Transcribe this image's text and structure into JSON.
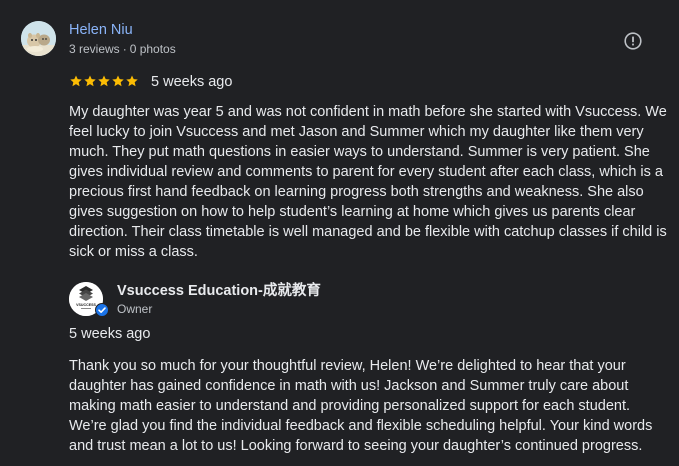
{
  "review": {
    "reviewer_name": "Helen Niu",
    "reviews_count": "3 reviews",
    "separator": "·",
    "photos_count": "0 photos",
    "rating": 5,
    "rating_max": 5,
    "star_color": "#fbbc04",
    "date": "5 weeks ago",
    "text": "My daughter was year 5 and was not confident in math before she started with Vsuccess. We feel lucky to join Vsuccess and met Jason and Summer which my daughter like them very much. They put math questions in easier ways to understand. Summer is very patient. She gives individual review and comments to parent for every student after each class, which is a precious first hand feedback on learning progress both strengths and weakness. She also gives suggestion on how to help student’s learning at home which gives us parents clear direction. Their class timetable is well managed and be flexible with catchup classes if child is sick or miss a class."
  },
  "owner_reply": {
    "owner_name": "Vsuccess Education-成就教育",
    "owner_role": "Owner",
    "logo_text": "VSUCCESS",
    "date": "5 weeks ago",
    "text": "Thank you so much for your thoughtful review, Helen! We’re delighted to hear that your daughter has gained confidence in math with us! Jackson and Summer truly care about making math easier to understand and providing personalized support for each student. We’re glad you find the individual feedback and flexible scheduling helpful. Your kind words and trust mean a lot to us! Looking forward to seeing your daughter’s continued progress."
  },
  "icons": {
    "report": "report-icon",
    "verified": "verified-check-icon",
    "star": "star-icon"
  },
  "colors": {
    "background": "#202124",
    "name_link": "#8ab4f8",
    "text": "#e8eaed",
    "secondary_text": "#bdc1c6",
    "verified_blue": "#1a73e8"
  }
}
